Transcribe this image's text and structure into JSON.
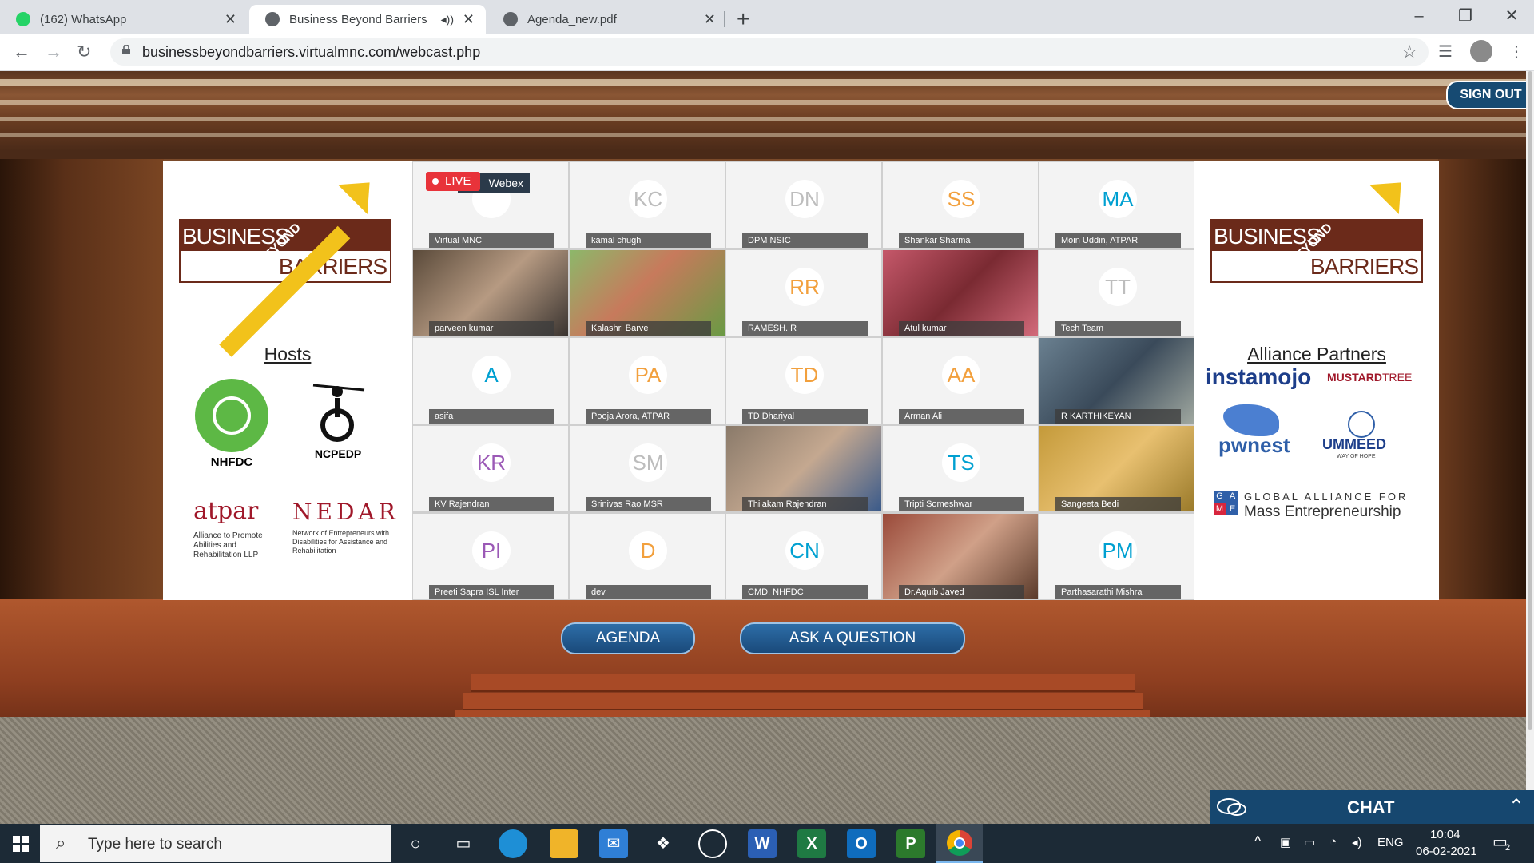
{
  "browser": {
    "tabs": [
      {
        "title": "(162) WhatsApp",
        "icon": "whatsapp-icon",
        "active": false
      },
      {
        "title": "Business Beyond Barriers",
        "icon": "globe-icon",
        "active": true
      },
      {
        "title": "Agenda_new.pdf",
        "icon": "globe-icon",
        "active": false
      }
    ],
    "url": "businessbeyondbarriers.virtualmnc.com/webcast.php"
  },
  "page": {
    "sign_out": "SIGN OUT",
    "left_panel": {
      "logo_word1": "BUSINESS",
      "logo_word2": "BEYOND",
      "logo_word3": "BARRIERS",
      "hosts_heading": "Hosts",
      "nhfdc": "NHFDC",
      "ncpedp": "NCPEDP",
      "atpar": "atpar",
      "atpar_sub": "Alliance to Promote Abilities and Rehabilitation LLP",
      "nedar": "NEDAR",
      "nedar_sub": "Network of Entrepreneurs with Disabilities for Assistance and Rehabilitation"
    },
    "right_panel": {
      "logo_word1": "BUSINESS",
      "logo_word2": "BEYOND",
      "logo_word3": "BARRIERS",
      "partners_heading": "Alliance Partners",
      "instamojo": "instamojo",
      "mustard": "MUSTARD",
      "mustard_tree": "TREE",
      "pwnest": "pwnest",
      "ummeed": "UMMEED",
      "ummeed_sub": "WAY OF HOPE",
      "game_line1": "GLOBAL ALLIANCE FOR",
      "game_line2": "Mass Entrepreneurship",
      "game_letters": [
        "G",
        "A",
        "M",
        "E"
      ]
    },
    "live_badge": "LIVE",
    "webex_label": "Webex",
    "participants": [
      {
        "initials": "",
        "name": "Virtual MNC"
      },
      {
        "initials": "KC",
        "name": "kamal chugh"
      },
      {
        "initials": "DN",
        "name": "DPM NSIC"
      },
      {
        "initials": "SS",
        "name": "Shankar Sharma"
      },
      {
        "initials": "MA",
        "name": "Moin Uddin, ATPAR"
      },
      {
        "initials": "",
        "name": "parveen kumar"
      },
      {
        "initials": "",
        "name": "Kalashri Barve"
      },
      {
        "initials": "RR",
        "name": "RAMESH. R"
      },
      {
        "initials": "",
        "name": "Atul kumar"
      },
      {
        "initials": "TT",
        "name": "Tech Team"
      },
      {
        "initials": "A",
        "name": "asifa"
      },
      {
        "initials": "PA",
        "name": "Pooja Arora, ATPAR"
      },
      {
        "initials": "TD",
        "name": "TD Dhariyal"
      },
      {
        "initials": "AA",
        "name": "Arman Ali"
      },
      {
        "initials": "",
        "name": "R KARTHIKEYAN"
      },
      {
        "initials": "KR",
        "name": "KV Rajendran"
      },
      {
        "initials": "SM",
        "name": "Srinivas Rao MSR"
      },
      {
        "initials": "",
        "name": "Thilakam Rajendran"
      },
      {
        "initials": "TS",
        "name": "Tripti Someshwar"
      },
      {
        "initials": "",
        "name": "Sangeeta Bedi"
      },
      {
        "initials": "PI",
        "name": "Preeti Sapra ISL Inter"
      },
      {
        "initials": "D",
        "name": "dev"
      },
      {
        "initials": "CN",
        "name": "CMD, NHFDC"
      },
      {
        "initials": "",
        "name": "Dr.Aquib Javed"
      },
      {
        "initials": "PM",
        "name": "Parthasarathi Mishra"
      }
    ],
    "agenda_button": "AGENDA",
    "ask_button": "ASK A QUESTION",
    "chat_label": "CHAT"
  },
  "taskbar": {
    "search_placeholder": "Type here to search",
    "language": "ENG",
    "time": "10:04",
    "date": "06-02-2021",
    "notifications": "2"
  },
  "colors": {
    "accent_blue": "#16476f",
    "live_red": "#e8333a",
    "logo_brown": "#6b2a1a",
    "logo_yellow": "#f2c21b"
  }
}
